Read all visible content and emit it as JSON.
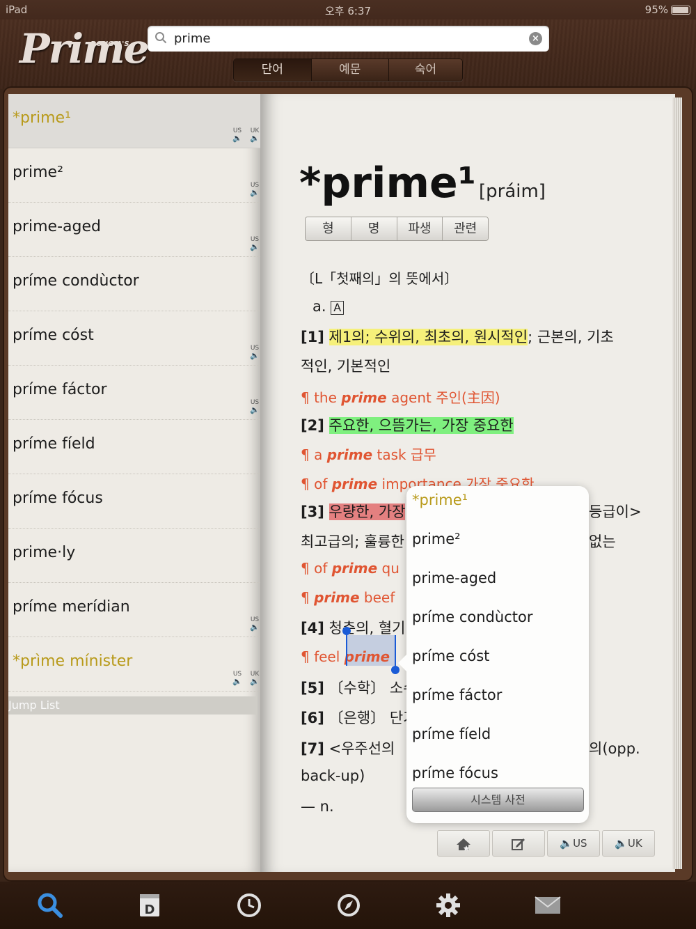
{
  "status_bar": {
    "device": "iPad",
    "time": "오후 6:37",
    "battery": "95%"
  },
  "logo": {
    "sub": "DONG-A'S",
    "main": "Prime"
  },
  "search": {
    "value": "prime"
  },
  "segments": [
    {
      "label": "단어",
      "active": true
    },
    {
      "label": "예문",
      "active": false
    },
    {
      "label": "숙어",
      "active": false
    }
  ],
  "word_list": {
    "items": [
      {
        "word": "*prime¹",
        "star": true,
        "us": true,
        "uk": true
      },
      {
        "word": "prime²",
        "star": false,
        "us": true,
        "uk": false
      },
      {
        "word": "prime-aged",
        "star": false,
        "us": true,
        "uk": false
      },
      {
        "word": "príme condùctor",
        "star": false,
        "us": false,
        "uk": false
      },
      {
        "word": "príme cóst",
        "star": false,
        "us": true,
        "uk": false
      },
      {
        "word": "príme fáctor",
        "star": false,
        "us": true,
        "uk": false
      },
      {
        "word": "príme fíeld",
        "star": false,
        "us": false,
        "uk": false
      },
      {
        "word": "príme fócus",
        "star": false,
        "us": false,
        "uk": false
      },
      {
        "word": "prime·ly",
        "star": false,
        "us": false,
        "uk": false
      },
      {
        "word": "príme merídian",
        "star": false,
        "us": true,
        "uk": false
      },
      {
        "word": "*prìme mínister",
        "star": true,
        "us": true,
        "uk": true
      }
    ],
    "us_label": "US",
    "uk_label": "UK",
    "jump_list": "Jump List"
  },
  "entry": {
    "headword": "*prime¹",
    "pronunciation": "[práim]",
    "pos_tabs": [
      "형",
      "명",
      "파생",
      "관련"
    ],
    "etymology": "〔L「첫째의」의 뜻에서〕",
    "pos": "a.",
    "pos_box": "A",
    "s1_num": "[1]",
    "s1_hl": "제1의; 수위의, 최초의, 원시적인",
    "s1_rest": "; 근본의, 기초",
    "s1_cont": "적인, 기본적인",
    "ex1_a": "¶ the ",
    "ex1_b": "prime",
    "ex1_c": " agent 주인(主因)",
    "s2_num": "[2]",
    "s2_hl": "주요한, 으뜸가는, 가장 중요한",
    "ex2_a": "¶ a ",
    "ex2_b": "prime",
    "ex2_c": " task 급무",
    "ex3_a": "¶ of ",
    "ex3_b": "prime",
    "ex3_c": " importance 가장 중요한",
    "s3_num": "[3]",
    "s3_hl": "우량한, 가장",
    "s3_tail": "등급이>",
    "s3_cont": "최고급의; 훌륭한",
    "s3_cont_tail": "없는",
    "ex4_a": "¶ of ",
    "ex4_b": "prime",
    "ex4_c": " qu",
    "ex5_a": "¶ ",
    "ex5_b": "prime",
    "ex5_c": " beef",
    "s4_num": "[4]",
    "s4_text": "청춘의, 혈기",
    "ex6_a": "¶ feel ",
    "ex6_b": "prime",
    "s5_num": "[5]",
    "s5_text": "〔수학〕 소수",
    "s6_num": "[6]",
    "s6_text": "〔은행〕 단기",
    "s7_num": "[7]",
    "s7_text": "<우주선의",
    "s7_tail": "의(opp.",
    "s7_cont": "back-up)",
    "noun": "— n."
  },
  "popover": {
    "items": [
      {
        "word": "*prime¹",
        "star": true
      },
      {
        "word": "prime²",
        "star": false
      },
      {
        "word": "prime-aged",
        "star": false
      },
      {
        "word": "príme condùctor",
        "star": false
      },
      {
        "word": "príme cóst",
        "star": false
      },
      {
        "word": "príme fáctor",
        "star": false
      },
      {
        "word": "príme fíeld",
        "star": false
      },
      {
        "word": "príme fócus",
        "star": false
      }
    ],
    "button": "시스템 사전"
  },
  "page_tools": {
    "us": "US",
    "uk": "UK"
  },
  "tab_bar": {
    "icons": [
      "search-icon",
      "dictionary-d-icon",
      "history-clock-icon",
      "compass-icon",
      "gear-icon",
      "mail-icon"
    ],
    "accent": "#3b8fe0"
  }
}
